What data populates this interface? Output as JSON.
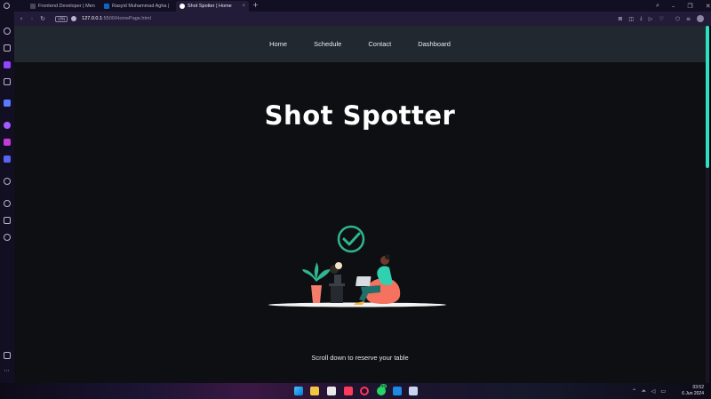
{
  "browser": {
    "tabs": [
      {
        "title": "Frontend Developer | Men"
      },
      {
        "title": "Rasyid Muhammad Agha |"
      },
      {
        "title": "Shot Spotter | Home"
      }
    ],
    "new_tab_label": "+",
    "url_host": "127.0.0.1",
    "url_rest": ":5500/HomePage.html"
  },
  "site": {
    "nav": [
      "Home",
      "Schedule",
      "Contact",
      "Dashboard"
    ],
    "title": "Shot Spotter",
    "scroll_hint": "Scroll down to reserve your table"
  },
  "taskbar": {
    "time": "03:52",
    "date": "6 Jun 2024",
    "badge": "99"
  },
  "colors": {
    "accent": "#2ce0c0",
    "nav_bg": "#212830",
    "page_bg": "#0e0f12"
  }
}
